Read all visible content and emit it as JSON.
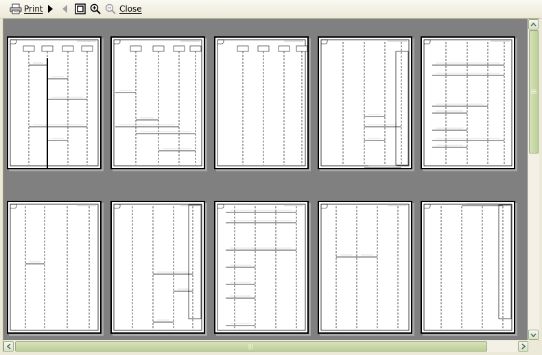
{
  "toolbar": {
    "print_label": "Print",
    "close_label": "Close",
    "icons": [
      "printer-icon",
      "next-page-icon",
      "previous-page-icon",
      "one-page-icon",
      "zoom-in-icon",
      "zoom-out-icon"
    ]
  },
  "preview": {
    "pages": [
      {
        "layout": "lifelines-header"
      },
      {
        "layout": "lifelines-header"
      },
      {
        "layout": "lifelines-header"
      },
      {
        "layout": "lifelines"
      },
      {
        "layout": "lifelines"
      },
      {
        "layout": "lifelines"
      },
      {
        "layout": "lifelines"
      },
      {
        "layout": "lifelines"
      },
      {
        "layout": "lifelines"
      },
      {
        "layout": "lifelines"
      }
    ]
  },
  "colors": {
    "canvas": "#808080",
    "chrome": "#ece9d8",
    "scroll_accent": "#bccf94"
  }
}
